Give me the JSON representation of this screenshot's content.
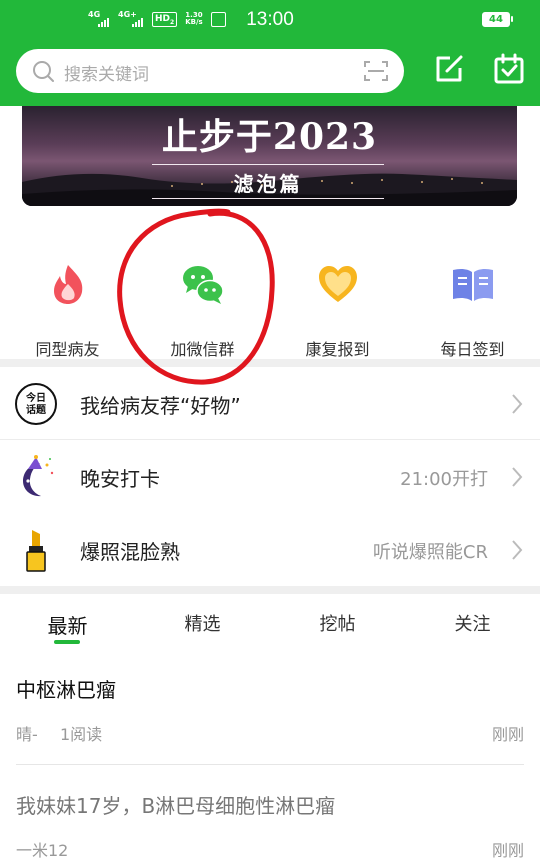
{
  "status_bar": {
    "signal1": "4G",
    "signal2": "4G+",
    "hd": "HD",
    "hd_sub": "2",
    "speed_value": "1.30",
    "speed_unit": "KB/s",
    "time": "13:00",
    "battery": "44"
  },
  "search": {
    "placeholder": "搜索关键词"
  },
  "banner": {
    "title": "止步于2023",
    "subtitle": "滤泡篇"
  },
  "shortcuts": [
    {
      "label": "同型病友",
      "icon": "flame-icon",
      "color": "#f2525c"
    },
    {
      "label": "加微信群",
      "icon": "wechat-icon",
      "color": "#3cc24b"
    },
    {
      "label": "康复报到",
      "icon": "heart-icon",
      "color": "#f7b51f"
    },
    {
      "label": "每日签到",
      "icon": "book-icon",
      "color": "#6e82e6"
    }
  ],
  "topics": [
    {
      "icon": "today-topic-icon",
      "title": "我给病友荐“好物”",
      "right": ""
    },
    {
      "icon": "moon-icon",
      "title": "晚安打卡",
      "right": "21:00开打"
    },
    {
      "icon": "lipstick-icon",
      "title": "爆照混脸熟",
      "right": "听说爆照能CR"
    }
  ],
  "tabs": [
    {
      "label": "最新",
      "active": true
    },
    {
      "label": "精选",
      "active": false
    },
    {
      "label": "挖帖",
      "active": false
    },
    {
      "label": "关注",
      "active": false
    }
  ],
  "posts": [
    {
      "title": "中枢淋巴瘤",
      "author": "晴-",
      "views": "1阅读",
      "time": "刚刚",
      "read": false
    },
    {
      "title": "我妹妹17岁，B淋巴母细胞性淋巴瘤",
      "author": "一米12",
      "views": "",
      "time": "刚刚",
      "read": true
    }
  ],
  "colors": {
    "brand_green": "#22b83a",
    "annotation_red": "#e0161e"
  }
}
